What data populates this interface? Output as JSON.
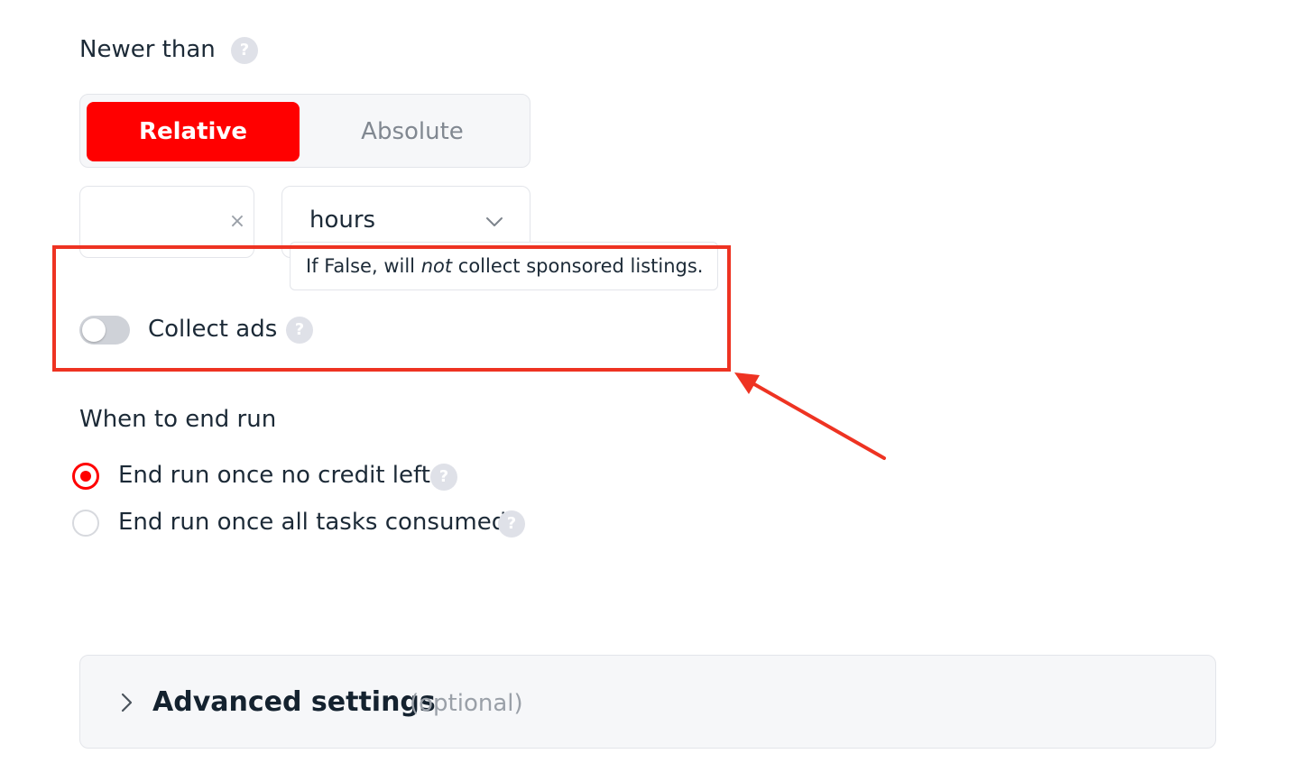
{
  "newer_than": {
    "title": "Newer than",
    "help_icon": "question-mark-icon",
    "segment": {
      "relative_label": "Relative",
      "absolute_label": "Absolute",
      "selected": "Relative"
    },
    "number_input": {
      "value": "",
      "clear_glyph": "×"
    },
    "unit_select": {
      "value": "hours"
    }
  },
  "tooltip": {
    "prefix": "If False, will ",
    "emphasis": "not",
    "suffix": " collect sponsored listings."
  },
  "collect_ads": {
    "label": "Collect ads",
    "enabled": false
  },
  "end_run": {
    "title": "When to end run",
    "options": [
      {
        "label": "End run once no credit left",
        "selected": true
      },
      {
        "label": "End run once all tasks consumed",
        "selected": false
      }
    ]
  },
  "advanced": {
    "title": "Advanced settings",
    "optional": "(optional)"
  },
  "colors": {
    "accent": "#ff0000",
    "annotation": "#ee3322",
    "muted": "#9aa0a8"
  }
}
